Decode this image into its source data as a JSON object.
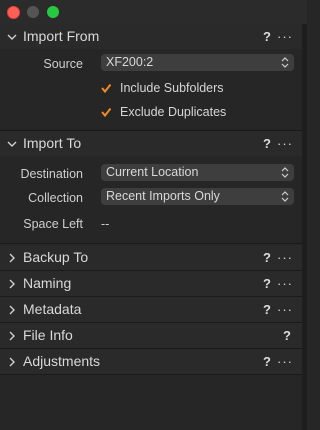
{
  "window": {
    "controls": [
      "close",
      "minimize",
      "zoom"
    ]
  },
  "import_from": {
    "title": "Import From",
    "help": "?",
    "more": "···",
    "source_label": "Source",
    "source_value": "XF200:2",
    "include_subfolders": {
      "label": "Include Subfolders",
      "checked": true
    },
    "exclude_duplicates": {
      "label": "Exclude Duplicates",
      "checked": true
    }
  },
  "import_to": {
    "title": "Import To",
    "help": "?",
    "more": "···",
    "destination_label": "Destination",
    "destination_value": "Current Location",
    "collection_label": "Collection",
    "collection_value": "Recent Imports Only",
    "space_left_label": "Space Left",
    "space_left_value": "--"
  },
  "backup_to": {
    "title": "Backup To",
    "help": "?",
    "more": "···"
  },
  "naming": {
    "title": "Naming",
    "help": "?",
    "more": "···"
  },
  "metadata": {
    "title": "Metadata",
    "help": "?",
    "more": "···"
  },
  "file_info": {
    "title": "File Info",
    "help": "?"
  },
  "adjustments": {
    "title": "Adjustments",
    "help": "?",
    "more": "···"
  },
  "colors": {
    "accent_check": "#f08a24",
    "background": "#262626",
    "header": "#2a2a2a"
  }
}
